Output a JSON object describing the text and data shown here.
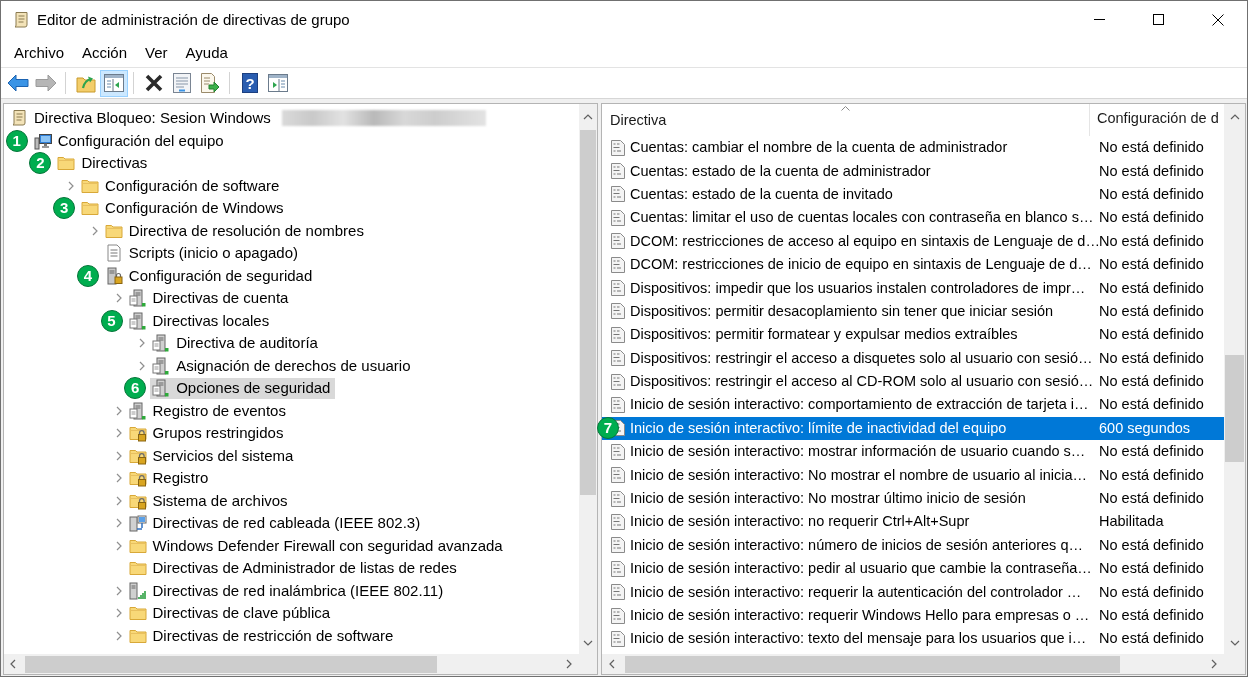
{
  "window": {
    "title": "Editor de administración de directivas de grupo"
  },
  "menu": [
    "Archivo",
    "Acción",
    "Ver",
    "Ayuda"
  ],
  "toolbar": [
    {
      "kind": "back",
      "pressed": false,
      "disabled": false
    },
    {
      "kind": "forward",
      "pressed": false,
      "disabled": true
    },
    {
      "kind": "separator"
    },
    {
      "kind": "up",
      "pressed": false,
      "disabled": false
    },
    {
      "kind": "tree-pane",
      "pressed": true,
      "disabled": false
    },
    {
      "kind": "separator"
    },
    {
      "kind": "delete",
      "pressed": false,
      "disabled": false
    },
    {
      "kind": "properties",
      "pressed": false,
      "disabled": false
    },
    {
      "kind": "export",
      "pressed": false,
      "disabled": false
    },
    {
      "kind": "separator"
    },
    {
      "kind": "help",
      "label": "?",
      "pressed": false,
      "disabled": false
    },
    {
      "kind": "action-pane",
      "pressed": false,
      "disabled": false
    }
  ],
  "tree": {
    "items": [
      {
        "label": "Directiva Bloqueo: Sesion Windows",
        "kind": "policy",
        "redacted": true,
        "expanded": true,
        "selected": false,
        "children": [
          {
            "label": "Configuración del equipo",
            "kind": "computer",
            "badge": "1",
            "expanded": true,
            "selected": false,
            "children": [
              {
                "label": "Directivas",
                "kind": "folder",
                "badge": "2",
                "expanded": true,
                "selected": false,
                "children": [
                  {
                    "label": "Configuración de software",
                    "kind": "folder",
                    "expanded": false,
                    "selected": false
                  },
                  {
                    "label": "Configuración de Windows",
                    "kind": "folder",
                    "badge": "3",
                    "expanded": true,
                    "selected": false,
                    "children": [
                      {
                        "label": "Directiva de resolución de nombres",
                        "kind": "folder",
                        "expanded": false,
                        "selected": false
                      },
                      {
                        "label": "Scripts (inicio o apagado)",
                        "kind": "script",
                        "selected": false
                      },
                      {
                        "label": "Configuración de seguridad",
                        "kind": "security",
                        "badge": "4",
                        "expanded": true,
                        "selected": false,
                        "children": [
                          {
                            "label": "Directivas de cuenta",
                            "kind": "server",
                            "expanded": false,
                            "selected": false
                          },
                          {
                            "label": "Directivas locales",
                            "kind": "server",
                            "badge": "5",
                            "expanded": true,
                            "selected": false,
                            "children": [
                              {
                                "label": "Directiva de auditoría",
                                "kind": "server",
                                "expanded": false,
                                "selected": false
                              },
                              {
                                "label": "Asignación de derechos de usuario",
                                "kind": "server",
                                "expanded": false,
                                "selected": false
                              },
                              {
                                "label": "Opciones de seguridad",
                                "kind": "server",
                                "badge": "6",
                                "selected": true
                              }
                            ]
                          },
                          {
                            "label": "Registro de eventos",
                            "kind": "server",
                            "expanded": false,
                            "selected": false
                          },
                          {
                            "label": "Grupos restringidos",
                            "kind": "locked-folder",
                            "expanded": false,
                            "selected": false
                          },
                          {
                            "label": "Servicios del sistema",
                            "kind": "locked-folder",
                            "expanded": false,
                            "selected": false
                          },
                          {
                            "label": "Registro",
                            "kind": "locked-folder",
                            "expanded": false,
                            "selected": false
                          },
                          {
                            "label": "Sistema de archivos",
                            "kind": "locked-folder",
                            "expanded": false,
                            "selected": false
                          },
                          {
                            "label": "Directivas de red cableada (IEEE 802.3)",
                            "kind": "network",
                            "expanded": false,
                            "selected": false
                          },
                          {
                            "label": "Windows Defender Firewall con seguridad avanzada",
                            "kind": "folder",
                            "expanded": false,
                            "selected": false
                          },
                          {
                            "label": "Directivas de Administrador de listas de redes",
                            "kind": "folder",
                            "selected": false
                          },
                          {
                            "label": "Directivas de red inalámbrica (IEEE 802.11)",
                            "kind": "wireless",
                            "expanded": false,
                            "selected": false
                          },
                          {
                            "label": "Directivas de clave pública",
                            "kind": "folder",
                            "expanded": false,
                            "selected": false
                          },
                          {
                            "label": "Directivas de restricción de software",
                            "kind": "folder",
                            "expanded": false,
                            "selected": false
                          }
                        ]
                      }
                    ]
                  }
                ]
              }
            ]
          }
        ]
      }
    ]
  },
  "list": {
    "columns": [
      {
        "label": "Directiva",
        "sorted": true
      },
      {
        "label": "Configuración de d",
        "sorted": false
      }
    ],
    "rows": [
      {
        "policy": "Cuentas: cambiar el nombre de la cuenta de administrador",
        "setting": "No está definido",
        "selected": false
      },
      {
        "policy": "Cuentas: estado de la cuenta de administrador",
        "setting": "No está definido",
        "selected": false
      },
      {
        "policy": "Cuentas: estado de la cuenta de invitado",
        "setting": "No está definido",
        "selected": false
      },
      {
        "policy": "Cuentas: limitar el uso de cuentas locales con contraseña en blanco s…",
        "setting": "No está definido",
        "selected": false
      },
      {
        "policy": "DCOM: restricciones de acceso al equipo en sintaxis de Lenguaje de d…",
        "setting": "No está definido",
        "selected": false
      },
      {
        "policy": "DCOM: restricciones de inicio de equipo en sintaxis de Lenguaje de d…",
        "setting": "No está definido",
        "selected": false
      },
      {
        "policy": "Dispositivos: impedir que los usuarios instalen controladores de impr…",
        "setting": "No está definido",
        "selected": false
      },
      {
        "policy": "Dispositivos: permitir desacoplamiento sin tener que iniciar sesión",
        "setting": "No está definido",
        "selected": false
      },
      {
        "policy": "Dispositivos: permitir formatear y expulsar medios extraíbles",
        "setting": "No está definido",
        "selected": false
      },
      {
        "policy": "Dispositivos: restringir el acceso a disquetes solo al usuario con sesió…",
        "setting": "No está definido",
        "selected": false
      },
      {
        "policy": "Dispositivos: restringir el acceso al CD-ROM solo al usuario con sesió…",
        "setting": "No está definido",
        "selected": false
      },
      {
        "policy": "Inicio de sesión interactivo: comportamiento de extracción de tarjeta i…",
        "setting": "No está definido",
        "selected": false
      },
      {
        "policy": "Inicio de sesión interactivo: límite de inactividad del equipo",
        "setting": "600 segundos",
        "selected": true,
        "badge": "7"
      },
      {
        "policy": "Inicio de sesión interactivo: mostrar información de usuario cuando s…",
        "setting": "No está definido",
        "selected": false
      },
      {
        "policy": "Inicio de sesión interactivo: No mostrar el nombre de usuario al inicia…",
        "setting": "No está definido",
        "selected": false
      },
      {
        "policy": "Inicio de sesión interactivo: No mostrar último inicio de sesión",
        "setting": "No está definido",
        "selected": false
      },
      {
        "policy": "Inicio de sesión interactivo: no requerir Ctrl+Alt+Supr",
        "setting": "Habilitada",
        "selected": false
      },
      {
        "policy": "Inicio de sesión interactivo: número de inicios de sesión anteriores q…",
        "setting": "No está definido",
        "selected": false
      },
      {
        "policy": "Inicio de sesión interactivo: pedir al usuario que cambie la contraseña…",
        "setting": "No está definido",
        "selected": false
      },
      {
        "policy": "Inicio de sesión interactivo: requerir la autenticación del controlador …",
        "setting": "No está definido",
        "selected": false
      },
      {
        "policy": "Inicio de sesión interactivo: requerir Windows Hello para empresas o …",
        "setting": "No está definido",
        "selected": false
      },
      {
        "policy": "Inicio de sesión interactivo: texto del mensaje para los usuarios que i…",
        "setting": "No está definido",
        "selected": false
      }
    ]
  }
}
